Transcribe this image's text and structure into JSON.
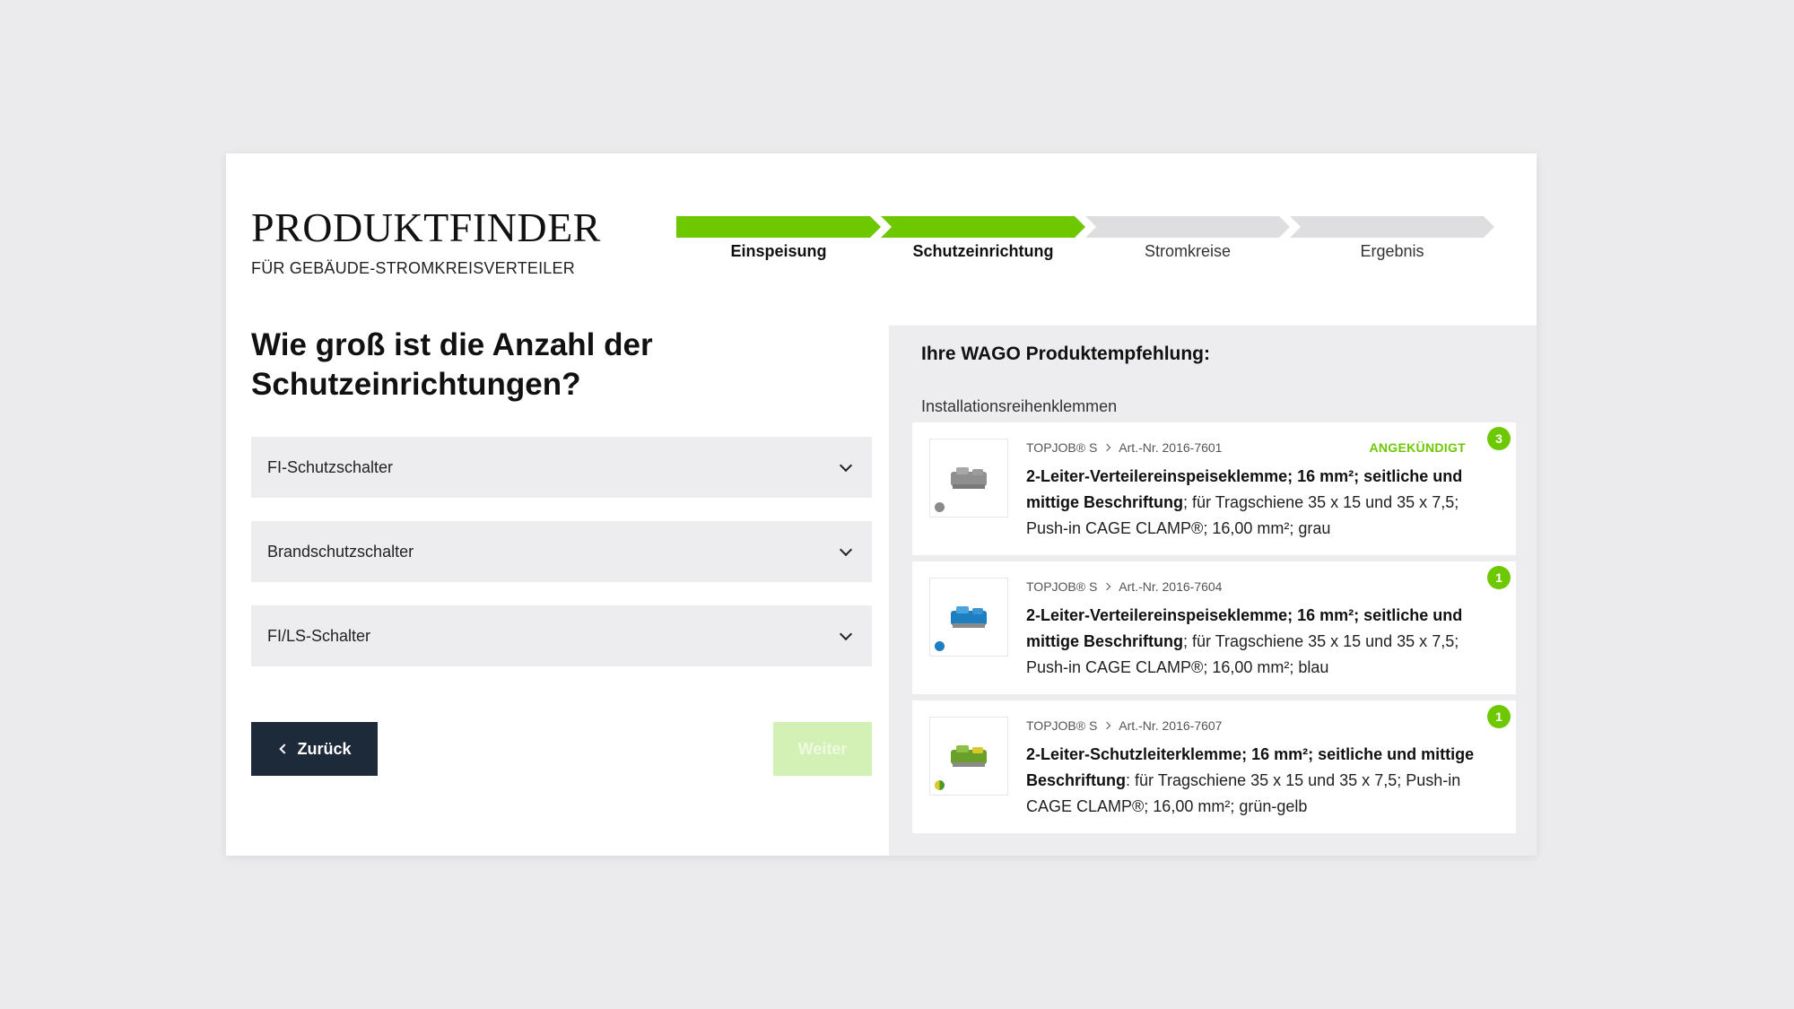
{
  "brand": {
    "title": "PRODUKTFINDER",
    "subtitle": "FÜR GEBÄUDE-STROMKREISVERTEILER"
  },
  "stepper": {
    "steps": [
      {
        "label": "Einspeisung",
        "done": true
      },
      {
        "label": "Schutzeinrichtung",
        "done": true
      },
      {
        "label": "Stromkreise",
        "done": false
      },
      {
        "label": "Ergebnis",
        "done": false
      }
    ]
  },
  "question": "Wie groß ist die Anzahl der Schutzeinrichtungen?",
  "selects": [
    {
      "label": "FI-Schutzschalter"
    },
    {
      "label": "Brandschutzschalter"
    },
    {
      "label": "FI/LS-Schalter"
    }
  ],
  "buttons": {
    "back": "Zurück",
    "next": "Weiter"
  },
  "panel": {
    "title": "Ihre WAGO Produktempfehlung:",
    "category": "Installationsreihenklemmen",
    "products": [
      {
        "series": "TOPJOB® S",
        "article": "Art.-Nr. 2016-7601",
        "status": "ANGEKÜNDIGT",
        "name": "2-Leiter-Verteilereinspeiseklemme; 16 mm²; seitliche und mittige Beschriftung",
        "details": "; für Tragschiene 35 x 15 und 35 x 7,5; Push-in CAGE CLAMP®; 16,00 mm²; grau",
        "count": "3",
        "color": "#8a8a8a"
      },
      {
        "series": "TOPJOB® S",
        "article": "Art.-Nr. 2016-7604",
        "status": "",
        "name": "2-Leiter-Verteilereinspeiseklemme; 16 mm²; seitliche und mittige Beschriftung",
        "details": "; für Tragschiene 35 x 15 und 35 x 7,5; Push-in CAGE CLAMP®; 16,00 mm²; blau",
        "count": "1",
        "color": "#1b7fc0"
      },
      {
        "series": "TOPJOB® S",
        "article": "Art.-Nr. 2016-7607",
        "status": "",
        "name": "2-Leiter-Schutzleiterklemme; 16 mm²; seitliche und mittige Beschriftung",
        "details": ": für Tragschiene 35 x 15 und 35 x 7,5; Push-in CAGE CLAMP®; 16,00 mm²; grün-gelb",
        "count": "1",
        "color": "#6aa02a"
      }
    ]
  },
  "colors": {
    "accent": "#6ec800",
    "dark_button": "#1d2a39",
    "background": "#ebebed"
  }
}
